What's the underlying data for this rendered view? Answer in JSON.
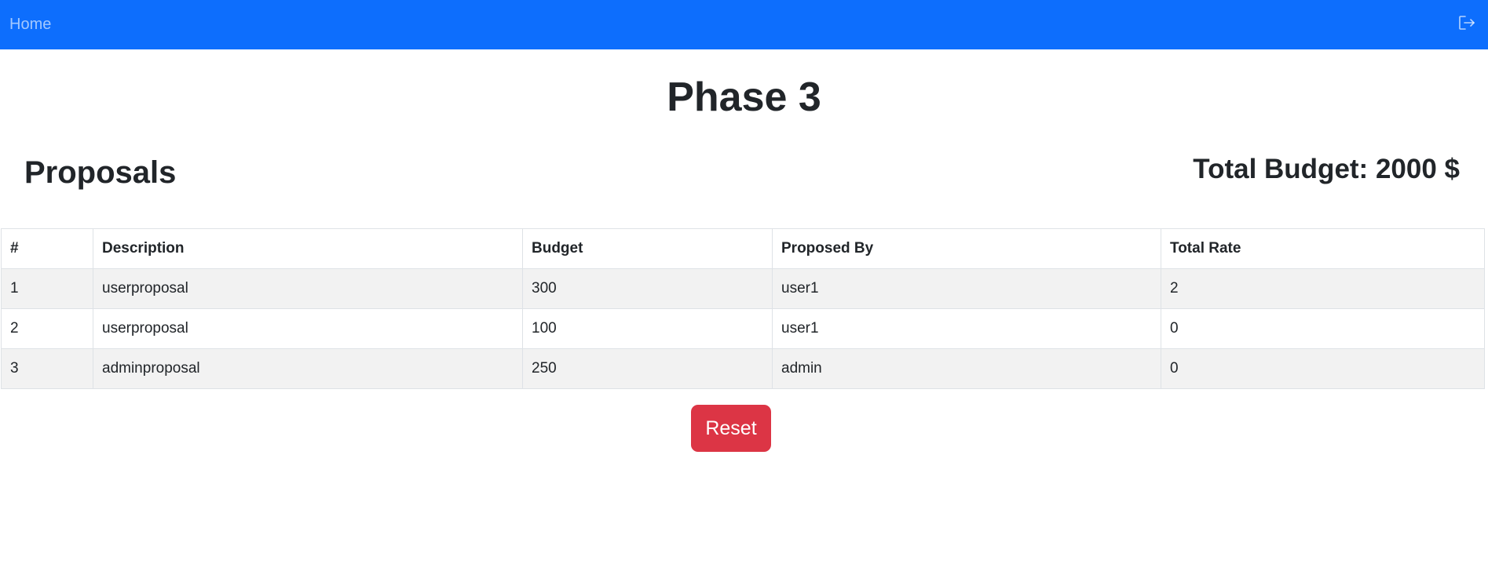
{
  "navbar": {
    "home_label": "Home",
    "logout_icon": "logout-icon",
    "brand_color": "#0d6efd"
  },
  "page": {
    "title": "Phase 3"
  },
  "section": {
    "title": "Proposals",
    "total_budget": "Total Budget: 2000 $"
  },
  "table": {
    "headers": [
      "#",
      "Description",
      "Budget",
      "Proposed By",
      "Total Rate"
    ],
    "rows": [
      [
        "1",
        "userproposal",
        "300",
        "user1",
        "2"
      ],
      [
        "2",
        "userproposal",
        "100",
        "user1",
        "0"
      ],
      [
        "3",
        "adminproposal",
        "250",
        "admin",
        "0"
      ]
    ]
  },
  "actions": {
    "reset_label": "Reset",
    "reset_color": "#dc3545"
  }
}
